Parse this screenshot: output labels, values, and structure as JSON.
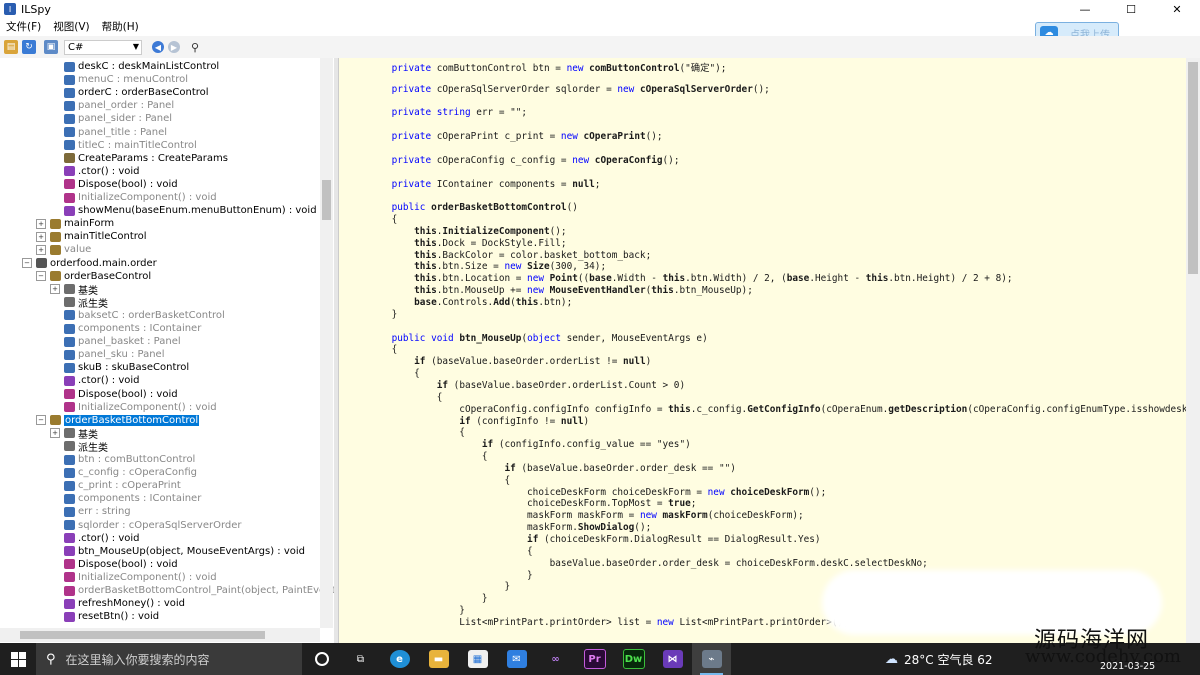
{
  "window": {
    "title": "ILSpy",
    "minimize": "—",
    "maximize": "☐",
    "close": "✕"
  },
  "menu": [
    "文件(F)",
    "视图(V)",
    "帮助(H)"
  ],
  "upload_button": {
    "label": "点我上传"
  },
  "toolbar": {
    "language": "C#"
  },
  "tree": [
    {
      "text": "deskC : deskMainListControl",
      "icon": "field-icon",
      "color": "#3c6fb4",
      "gray": false,
      "indent": 64,
      "exp": ""
    },
    {
      "text": "menuC : menuControl",
      "icon": "field-icon",
      "color": "#3c6fb4",
      "gray": true,
      "indent": 64,
      "exp": ""
    },
    {
      "text": "orderC : orderBaseControl",
      "icon": "field-icon",
      "color": "#3c6fb4",
      "gray": false,
      "indent": 64,
      "exp": ""
    },
    {
      "text": "panel_order : Panel",
      "icon": "field-icon",
      "color": "#3c6fb4",
      "gray": true,
      "indent": 64,
      "exp": ""
    },
    {
      "text": "panel_sider : Panel",
      "icon": "field-icon",
      "color": "#3c6fb4",
      "gray": true,
      "indent": 64,
      "exp": ""
    },
    {
      "text": "panel_title : Panel",
      "icon": "field-icon",
      "color": "#3c6fb4",
      "gray": true,
      "indent": 64,
      "exp": ""
    },
    {
      "text": "titleC : mainTitleControl",
      "icon": "field-icon",
      "color": "#3c6fb4",
      "gray": true,
      "indent": 64,
      "exp": ""
    },
    {
      "text": "CreateParams : CreateParams",
      "icon": "property-icon",
      "color": "#7d6a3a",
      "gray": false,
      "indent": 64,
      "exp": ""
    },
    {
      "text": ".ctor() : void",
      "icon": "method-icon",
      "color": "#8a3fb8",
      "gray": false,
      "indent": 64,
      "exp": ""
    },
    {
      "text": "Dispose(bool) : void",
      "icon": "method-icon",
      "color": "#b0338a",
      "gray": false,
      "indent": 64,
      "exp": ""
    },
    {
      "text": "InitializeComponent() : void",
      "icon": "method-icon",
      "color": "#b0338a",
      "gray": true,
      "indent": 64,
      "exp": ""
    },
    {
      "text": "showMenu(baseEnum.menuButtonEnum) : void",
      "icon": "method-icon",
      "color": "#8a3fb8",
      "gray": false,
      "indent": 64,
      "exp": ""
    },
    {
      "text": "mainForm",
      "icon": "class-icon",
      "color": "#9a7b2f",
      "gray": false,
      "indent": 50,
      "exp": "+"
    },
    {
      "text": "mainTitleControl",
      "icon": "class-icon",
      "color": "#9a7b2f",
      "gray": false,
      "indent": 50,
      "exp": "+"
    },
    {
      "text": "value",
      "icon": "class-icon",
      "color": "#9a7b2f",
      "gray": true,
      "indent": 50,
      "exp": "+"
    },
    {
      "text": "orderfood.main.order",
      "icon": "namespace-icon",
      "color": "#555555",
      "gray": false,
      "indent": 36,
      "exp": "−"
    },
    {
      "text": "orderBaseControl",
      "icon": "class-icon",
      "color": "#9a7b2f",
      "gray": false,
      "indent": 50,
      "exp": "−"
    },
    {
      "text": "基类",
      "icon": "folder-icon",
      "color": "#6d6d6d",
      "gray": false,
      "indent": 64,
      "exp": "+"
    },
    {
      "text": "派生类",
      "icon": "folder-icon",
      "color": "#6d6d6d",
      "gray": false,
      "indent": 64,
      "exp": ""
    },
    {
      "text": "baksetC : orderBasketControl",
      "icon": "field-icon",
      "color": "#3c6fb4",
      "gray": true,
      "indent": 64,
      "exp": ""
    },
    {
      "text": "components : IContainer",
      "icon": "field-icon",
      "color": "#3c6fb4",
      "gray": true,
      "indent": 64,
      "exp": ""
    },
    {
      "text": "panel_basket : Panel",
      "icon": "field-icon",
      "color": "#3c6fb4",
      "gray": true,
      "indent": 64,
      "exp": ""
    },
    {
      "text": "panel_sku : Panel",
      "icon": "field-icon",
      "color": "#3c6fb4",
      "gray": true,
      "indent": 64,
      "exp": ""
    },
    {
      "text": "skuB : skuBaseControl",
      "icon": "field-icon",
      "color": "#3c6fb4",
      "gray": false,
      "indent": 64,
      "exp": ""
    },
    {
      "text": ".ctor() : void",
      "icon": "method-icon",
      "color": "#8a3fb8",
      "gray": false,
      "indent": 64,
      "exp": ""
    },
    {
      "text": "Dispose(bool) : void",
      "icon": "method-icon",
      "color": "#b0338a",
      "gray": false,
      "indent": 64,
      "exp": ""
    },
    {
      "text": "InitializeComponent() : void",
      "icon": "method-icon",
      "color": "#b0338a",
      "gray": true,
      "indent": 64,
      "exp": ""
    },
    {
      "text": "orderBasketBottomControl",
      "icon": "class-icon",
      "color": "#9a7b2f",
      "gray": false,
      "indent": 50,
      "exp": "−",
      "selected": true
    },
    {
      "text": "基类",
      "icon": "folder-icon",
      "color": "#6d6d6d",
      "gray": false,
      "indent": 64,
      "exp": "+"
    },
    {
      "text": "派生类",
      "icon": "folder-icon",
      "color": "#6d6d6d",
      "gray": false,
      "indent": 64,
      "exp": ""
    },
    {
      "text": "btn : comButtonControl",
      "icon": "field-icon",
      "color": "#3c6fb4",
      "gray": true,
      "indent": 64,
      "exp": ""
    },
    {
      "text": "c_config : cOperaConfig",
      "icon": "field-icon",
      "color": "#3c6fb4",
      "gray": true,
      "indent": 64,
      "exp": ""
    },
    {
      "text": "c_print : cOperaPrint",
      "icon": "field-icon",
      "color": "#3c6fb4",
      "gray": true,
      "indent": 64,
      "exp": ""
    },
    {
      "text": "components : IContainer",
      "icon": "field-icon",
      "color": "#3c6fb4",
      "gray": true,
      "indent": 64,
      "exp": ""
    },
    {
      "text": "err : string",
      "icon": "field-icon",
      "color": "#3c6fb4",
      "gray": true,
      "indent": 64,
      "exp": ""
    },
    {
      "text": "sqlorder : cOperaSqlServerOrder",
      "icon": "field-icon",
      "color": "#3c6fb4",
      "gray": true,
      "indent": 64,
      "exp": ""
    },
    {
      "text": ".ctor() : void",
      "icon": "method-icon",
      "color": "#8a3fb8",
      "gray": false,
      "indent": 64,
      "exp": ""
    },
    {
      "text": "btn_MouseUp(object, MouseEventArgs) : void",
      "icon": "method-icon",
      "color": "#8a3fb8",
      "gray": false,
      "indent": 64,
      "exp": ""
    },
    {
      "text": "Dispose(bool) : void",
      "icon": "method-icon",
      "color": "#b0338a",
      "gray": false,
      "indent": 64,
      "exp": ""
    },
    {
      "text": "InitializeComponent() : void",
      "icon": "method-icon",
      "color": "#b0338a",
      "gray": true,
      "indent": 64,
      "exp": ""
    },
    {
      "text": "orderBasketBottomControl_Paint(object, PaintEventA",
      "icon": "method-icon",
      "color": "#b0338a",
      "gray": true,
      "indent": 64,
      "exp": ""
    },
    {
      "text": "refreshMoney() : void",
      "icon": "method-icon",
      "color": "#8a3fb8",
      "gray": false,
      "indent": 64,
      "exp": ""
    },
    {
      "text": "resetBtn() : void",
      "icon": "method-icon",
      "color": "#8a3fb8",
      "gray": false,
      "indent": 64,
      "exp": ""
    }
  ],
  "code": [
    [
      [
        "    ",
        ""
      ],
      [
        "private",
        "kw"
      ],
      [
        " comButtonControl btn = ",
        ""
      ],
      [
        "new",
        "kw"
      ],
      [
        " ",
        ""
      ],
      [
        "comButtonControl",
        "bold"
      ],
      [
        "(\"确定\");",
        ""
      ]
    ],
    [],
    [
      [
        "    ",
        ""
      ],
      [
        "private",
        "kw"
      ],
      [
        " cOperaSqlServerOrder sqlorder = ",
        ""
      ],
      [
        "new",
        "kw"
      ],
      [
        " ",
        ""
      ],
      [
        "cOperaSqlServerOrder",
        "bold"
      ],
      [
        "();",
        ""
      ]
    ],
    [],
    [
      [
        "    ",
        ""
      ],
      [
        "private",
        "kw"
      ],
      [
        " ",
        ""
      ],
      [
        "string",
        "kw"
      ],
      [
        " err = \"\";",
        ""
      ]
    ],
    [],
    [
      [
        "    ",
        ""
      ],
      [
        "private",
        "kw"
      ],
      [
        " cOperaPrint c_print = ",
        ""
      ],
      [
        "new",
        "kw"
      ],
      [
        " ",
        ""
      ],
      [
        "cOperaPrint",
        "bold"
      ],
      [
        "();",
        ""
      ]
    ],
    [],
    [
      [
        "    ",
        ""
      ],
      [
        "private",
        "kw"
      ],
      [
        " cOperaConfig c_config = ",
        ""
      ],
      [
        "new",
        "kw"
      ],
      [
        " ",
        ""
      ],
      [
        "cOperaConfig",
        "bold"
      ],
      [
        "();",
        ""
      ]
    ],
    [],
    [
      [
        "    ",
        ""
      ],
      [
        "private",
        "kw"
      ],
      [
        " IContainer components = ",
        ""
      ],
      [
        "null",
        "bold"
      ],
      [
        ";",
        ""
      ]
    ],
    [],
    [
      [
        "    ",
        ""
      ],
      [
        "public",
        "kw"
      ],
      [
        " ",
        ""
      ],
      [
        "orderBasketBottomControl",
        "bold"
      ],
      [
        "()",
        ""
      ]
    ],
    [
      [
        "    {",
        ""
      ]
    ],
    [
      [
        "        ",
        ""
      ],
      [
        "this",
        "bold"
      ],
      [
        ".",
        ""
      ],
      [
        "InitializeComponent",
        "bold"
      ],
      [
        "();",
        ""
      ]
    ],
    [
      [
        "        ",
        ""
      ],
      [
        "this",
        "bold"
      ],
      [
        ".Dock = DockStyle.Fill;",
        ""
      ]
    ],
    [
      [
        "        ",
        ""
      ],
      [
        "this",
        "bold"
      ],
      [
        ".BackColor = color.basket_bottom_back;",
        ""
      ]
    ],
    [
      [
        "        ",
        ""
      ],
      [
        "this",
        "bold"
      ],
      [
        ".btn.Size = ",
        ""
      ],
      [
        "new",
        "kw"
      ],
      [
        " ",
        ""
      ],
      [
        "Size",
        "bold"
      ],
      [
        "(300, 34);",
        ""
      ]
    ],
    [
      [
        "        ",
        ""
      ],
      [
        "this",
        "bold"
      ],
      [
        ".btn.Location = ",
        ""
      ],
      [
        "new",
        "kw"
      ],
      [
        " ",
        ""
      ],
      [
        "Point",
        "bold"
      ],
      [
        "((",
        ""
      ],
      [
        "base",
        "bold"
      ],
      [
        ".Width - ",
        ""
      ],
      [
        "this",
        "bold"
      ],
      [
        ".btn.Width) / 2, (",
        ""
      ],
      [
        "base",
        "bold"
      ],
      [
        ".Height - ",
        ""
      ],
      [
        "this",
        "bold"
      ],
      [
        ".btn.Height) / 2 + 8);",
        ""
      ]
    ],
    [
      [
        "        ",
        ""
      ],
      [
        "this",
        "bold"
      ],
      [
        ".btn.MouseUp += ",
        ""
      ],
      [
        "new",
        "kw"
      ],
      [
        " ",
        ""
      ],
      [
        "MouseEventHandler",
        "bold"
      ],
      [
        "(",
        ""
      ],
      [
        "this",
        "bold"
      ],
      [
        ".btn_MouseUp);",
        ""
      ]
    ],
    [
      [
        "        ",
        ""
      ],
      [
        "base",
        "bold"
      ],
      [
        ".Controls.",
        ""
      ],
      [
        "Add",
        "bold"
      ],
      [
        "(",
        ""
      ],
      [
        "this",
        "bold"
      ],
      [
        ".btn);",
        ""
      ]
    ],
    [
      [
        "    }",
        ""
      ]
    ],
    [],
    [
      [
        "    ",
        ""
      ],
      [
        "public",
        "kw"
      ],
      [
        " ",
        ""
      ],
      [
        "void",
        "kw"
      ],
      [
        " ",
        ""
      ],
      [
        "btn_MouseUp",
        "bold"
      ],
      [
        "(",
        ""
      ],
      [
        "object",
        "kw"
      ],
      [
        " sender, MouseEventArgs e)",
        ""
      ]
    ],
    [
      [
        "    {",
        ""
      ]
    ],
    [
      [
        "        ",
        ""
      ],
      [
        "if",
        "bold"
      ],
      [
        " (baseValue.baseOrder.orderList != ",
        ""
      ],
      [
        "null",
        "bold"
      ],
      [
        ")",
        ""
      ]
    ],
    [
      [
        "        {",
        ""
      ]
    ],
    [
      [
        "            ",
        ""
      ],
      [
        "if",
        "bold"
      ],
      [
        " (baseValue.baseOrder.orderList.Count > 0)",
        ""
      ]
    ],
    [
      [
        "            {",
        ""
      ]
    ],
    [
      [
        "                cOperaConfig.configInfo configInfo = ",
        ""
      ],
      [
        "this",
        "bold"
      ],
      [
        ".c_config.",
        ""
      ],
      [
        "GetConfigInfo",
        "bold"
      ],
      [
        "(cOperaEnum.",
        ""
      ],
      [
        "getDescription",
        "bold"
      ],
      [
        "(cOperaConfig.configEnumType.isshowdesk",
        ""
      ]
    ],
    [
      [
        "                ",
        ""
      ],
      [
        "if",
        "bold"
      ],
      [
        " (configInfo != ",
        ""
      ],
      [
        "null",
        "bold"
      ],
      [
        ")",
        ""
      ]
    ],
    [
      [
        "                {",
        ""
      ]
    ],
    [
      [
        "                    ",
        ""
      ],
      [
        "if",
        "bold"
      ],
      [
        " (configInfo.config_value == \"yes\")",
        ""
      ]
    ],
    [
      [
        "                    {",
        ""
      ]
    ],
    [
      [
        "                        ",
        ""
      ],
      [
        "if",
        "bold"
      ],
      [
        " (baseValue.baseOrder.order_desk == \"\")",
        ""
      ]
    ],
    [
      [
        "                        {",
        ""
      ]
    ],
    [
      [
        "                            choiceDeskForm choiceDeskForm = ",
        ""
      ],
      [
        "new",
        "kw"
      ],
      [
        " ",
        ""
      ],
      [
        "choiceDeskForm",
        "bold"
      ],
      [
        "();",
        ""
      ]
    ],
    [
      [
        "                            choiceDeskForm.TopMost = ",
        ""
      ],
      [
        "true",
        "bold"
      ],
      [
        ";",
        ""
      ]
    ],
    [
      [
        "                            maskForm maskForm = ",
        ""
      ],
      [
        "new",
        "kw"
      ],
      [
        " ",
        ""
      ],
      [
        "maskForm",
        "bold"
      ],
      [
        "(choiceDeskForm);",
        ""
      ]
    ],
    [
      [
        "                            maskForm.",
        ""
      ],
      [
        "ShowDialog",
        "bold"
      ],
      [
        "();",
        ""
      ]
    ],
    [
      [
        "                            ",
        ""
      ],
      [
        "if",
        "bold"
      ],
      [
        " (choiceDeskForm.DialogResult == DialogResult.Yes)",
        ""
      ]
    ],
    [
      [
        "                            {",
        ""
      ]
    ],
    [
      [
        "                                baseValue.baseOrder.order_desk = choiceDeskForm.deskC.selectDeskNo;",
        ""
      ]
    ],
    [
      [
        "                            }",
        ""
      ]
    ],
    [
      [
        "                        }",
        ""
      ]
    ],
    [
      [
        "                    }",
        ""
      ]
    ],
    [
      [
        "                }",
        ""
      ]
    ],
    [
      [
        "                List<mPrintPart.printOrder> list = ",
        ""
      ],
      [
        "new",
        "kw"
      ],
      [
        " List<mPrintPart.printOrder>();",
        ""
      ]
    ]
  ],
  "taskbar": {
    "search_placeholder": "在这里输入你要搜索的内容",
    "weather": "28°C  空气良 62",
    "date": "2021-03-25"
  },
  "watermark": {
    "line1": "源码海洋网",
    "line2": "www.codehy.com"
  }
}
